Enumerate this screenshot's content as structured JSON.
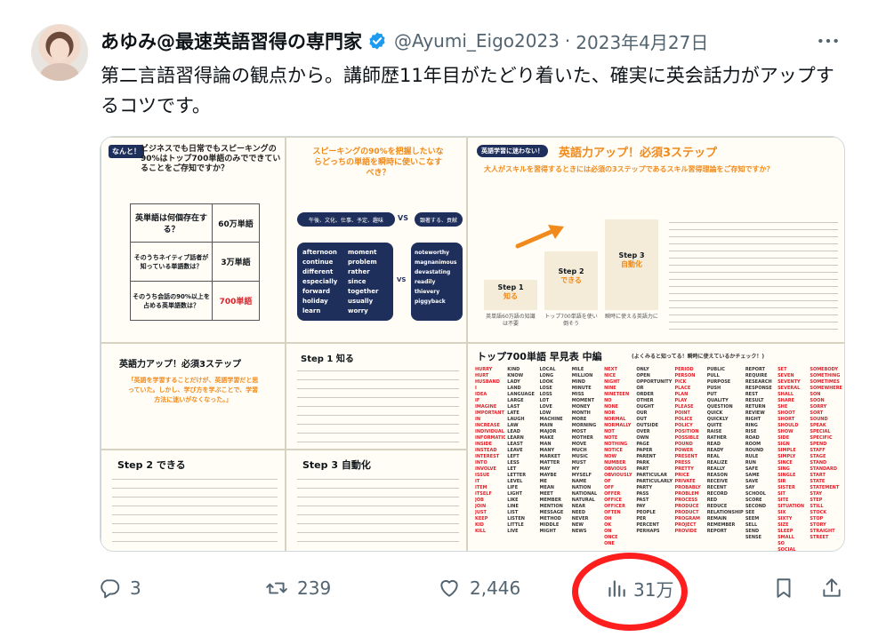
{
  "user": {
    "display_name": "あゆみ@最速英語習得の専門家",
    "handle": "@Ayumi_Eigo2023",
    "separator": "·",
    "date": "2023年4月27日"
  },
  "tweet_text": "第二言語習得論の観点から。講師歴11年目がたどり着いた、確実に英会話力がアップするコツです。",
  "media": {
    "p1_tag": "なんと！",
    "p1_title": "ビジネスでも日常でもスピーキングの90%はトップ700単語のみでできていることをご存知ですか？",
    "p1_rows": [
      {
        "q": "英単語は何個存在する？",
        "a": "60万単語"
      },
      {
        "q": "そのうちネイティブ話者が知っている単語数は？",
        "a": "3万単語"
      },
      {
        "q": "そのうち会話の90%以上を占める英単語数は？",
        "a": "700単語"
      }
    ],
    "p2_title": "スピーキングの90%を把握したいならどっちの単語を瞬時に使いこなすべき？",
    "p2_left_box": "午後、文化、仕事、予定、趣味",
    "p2_vs": "VS",
    "p2_right_box": "顕著する、貢献",
    "p2_left_words": [
      "afternoon",
      "continue",
      "different",
      "especially",
      "forward",
      "holiday",
      "learn"
    ],
    "p2_left_words2": [
      "moment",
      "problem",
      "rather",
      "since",
      "together",
      "usually",
      "worry"
    ],
    "p2_right_words": [
      "noteworthy",
      "magnanimous",
      "devastating",
      "readily",
      "thievery",
      "piggyback"
    ],
    "p3_tag": "英語学習に迷わない！",
    "p3_title": "英語力アップ！必須3ステップ",
    "p3_subtitle": "大人がスキルを習得するときには必須の3ステップであるスキル習得理論をご存知ですか？",
    "p3_steps": [
      {
        "label": "Step 1",
        "word": "知る",
        "desc": "英単語60万語の知識は不要"
      },
      {
        "label": "Step 2",
        "word": "できる",
        "desc": "トップ700単語を使い倒そう"
      },
      {
        "label": "Step 3",
        "word": "自動化",
        "desc": "瞬時に使える英語力に"
      }
    ],
    "p4_title": "英語力アップ！必須3ステップ",
    "p4_quote": "「英語を学習することだけが、英語学習だと思っていた。しかし、学び方を学ぶことで、学習方法に迷いがなくなった。」",
    "p5_title": "Step 1 知る",
    "p6_title": "トップ700単語 早見表 中編",
    "p6_note": "(よくみると知ってる！瞬時に使えているかチェック！)",
    "p6_words": [
      "HURRY",
      "HURT",
      "HUSBAND",
      "I",
      "IDEA",
      "IF",
      "IMAGINE",
      "IMPORTANT",
      "IN",
      "INCREASE",
      "INDIVIDUAL",
      "INFORMATION",
      "INSIDE",
      "INSTEAD",
      "INTEREST",
      "INTO",
      "INVOLVE",
      "ISSUE",
      "IT",
      "ITEM",
      "ITSELF",
      "JOB",
      "JOIN",
      "JUST",
      "KEEP",
      "KID",
      "KILL"
    ],
    "p6_words2": [
      "KIND",
      "KNOW",
      "LADY",
      "LAND",
      "LANGUAGE",
      "LARGE",
      "LAST",
      "LATE",
      "LAUGH",
      "LAW",
      "LEAD",
      "LEARN",
      "LEAST",
      "LEAVE",
      "LEFT",
      "LESS",
      "LET",
      "LETTER",
      "LEVEL",
      "LIFE",
      "LIGHT",
      "LIKE",
      "LINE",
      "LIST",
      "LISTEN",
      "LITTLE",
      "LIVE"
    ],
    "p6_words3": [
      "LOCAL",
      "LONG",
      "LOOK",
      "LOSE",
      "LOSS",
      "LOT",
      "LOVE",
      "LOW",
      "MACHINE",
      "MAIN",
      "MAJOR",
      "MAKE",
      "MAN",
      "MANY",
      "MARKET",
      "MATTER",
      "MAY",
      "MAYBE",
      "ME",
      "MEAN",
      "MEET",
      "MEMBER",
      "MENTION",
      "MESSAGE",
      "METHOD",
      "MIDDLE",
      "MIGHT"
    ],
    "p6_words4": [
      "MILE",
      "MILLION",
      "MIND",
      "MINUTE",
      "MISS",
      "MOMENT",
      "MONEY",
      "MONTH",
      "MORE",
      "MORNING",
      "MOST",
      "MOTHER",
      "MOVE",
      "MUCH",
      "MUSIC",
      "MUST",
      "MY",
      "MYSELF",
      "NAME",
      "NATION",
      "NATIONAL",
      "NATURAL",
      "NEAR",
      "NEED",
      "NEVER",
      "NEW",
      "NEWS"
    ],
    "p6_words5": [
      "NEXT",
      "NICE",
      "NIGHT",
      "NINE",
      "NINETEEN",
      "NO",
      "NONE",
      "NOR",
      "NORMAL",
      "NORMALLY",
      "NOT",
      "NOTE",
      "NOTHING",
      "NOTICE",
      "NOW",
      "NUMBER",
      "OBVIOUS",
      "OBVIOUSLY",
      "OF",
      "OFF",
      "OFFER",
      "OFFICE",
      "OFFICER",
      "OFTEN",
      "OH",
      "OK",
      "ON",
      "ONCE",
      "ONE"
    ],
    "p6_words6": [
      "ONLY",
      "OPEN",
      "OPPORTUNITY",
      "OR",
      "ORDER",
      "OTHER",
      "OUGHT",
      "OUR",
      "OUT",
      "OUTSIDE",
      "OVER",
      "OWN",
      "PAGE",
      "PAPER",
      "PARENT",
      "PARK",
      "PART",
      "PARTICULAR",
      "PARTICULARLY",
      "PARTY",
      "PASS",
      "PAST",
      "PAY",
      "PEOPLE",
      "PER",
      "PERCENT",
      "PERHAPS"
    ],
    "p6_words7": [
      "PERIOD",
      "PERSON",
      "PICK",
      "PLACE",
      "PLAN",
      "PLAY",
      "PLEASE",
      "POINT",
      "POLICE",
      "POLICY",
      "POSITION",
      "POSSIBLE",
      "POUND",
      "POWER",
      "PRESENT",
      "PRESS",
      "PRETTY",
      "PRICE",
      "PRIVATE",
      "PROBABLY",
      "PROBLEM",
      "PROCESS",
      "PRODUCE",
      "PRODUCT",
      "PROGRAM",
      "PROJECT",
      "PROVIDE"
    ],
    "p6_words8": [
      "PUBLIC",
      "PULL",
      "PURPOSE",
      "PUSH",
      "PUT",
      "QUALITY",
      "QUESTION",
      "QUICK",
      "QUICKLY",
      "QUITE",
      "RAISE",
      "RATHER",
      "READ",
      "READY",
      "REAL",
      "REALIZE",
      "REALLY",
      "REASON",
      "RECEIVE",
      "RECENT",
      "RECORD",
      "RED",
      "REDUCE",
      "RELATIONSHIP",
      "REMAIN",
      "REMEMBER",
      "REPORT"
    ],
    "p6_words9": [
      "REPORT",
      "REQUIRE",
      "RESEARCH",
      "RESPONSE",
      "REST",
      "RESULT",
      "RETURN",
      "REVIEW",
      "RIGHT",
      "RING",
      "RISE",
      "ROAD",
      "ROOM",
      "ROUND",
      "RULE",
      "RUN",
      "SAFE",
      "SAME",
      "SAVE",
      "SAY",
      "SCHOOL",
      "SCORE",
      "SECOND",
      "SEE",
      "SEEM",
      "SELL",
      "SEND",
      "SENSE"
    ],
    "p6_words10": [
      "SET",
      "SEVEN",
      "SEVENTY",
      "SEVERAL",
      "SHALL",
      "SHARE",
      "SHE",
      "SHOOT",
      "SHORT",
      "SHOULD",
      "SHOW",
      "SIDE",
      "SIGN",
      "SIMPLE",
      "SIMPLY",
      "SINCE",
      "SING",
      "SINGLE",
      "SIR",
      "SISTER",
      "SIT",
      "SITE",
      "SITUATION",
      "SIX",
      "SIXTY",
      "SIZE",
      "SLEEP",
      "SMALL",
      "SO",
      "SOCIAL"
    ],
    "p6_words11": [
      "SOMEBODY",
      "SOMETHING",
      "SOMETIMES",
      "SOMEWHERE",
      "SON",
      "SOON",
      "SORRY",
      "SORT",
      "SOUND",
      "SPEAK",
      "SPECIAL",
      "SPECIFIC",
      "SPEND",
      "STAFF",
      "STAGE",
      "STAND",
      "STANDARD",
      "START",
      "STATE",
      "STATEMENT",
      "STAY",
      "STEP",
      "STILL",
      "STOCK",
      "STOP",
      "STORY",
      "STRAIGHT",
      "STREET"
    ],
    "p7_title": "Step 2 できる",
    "p8_title": "Step 3 自動化"
  },
  "actions": {
    "reply_count": "3",
    "retweet_count": "239",
    "like_count": "2,446",
    "views_count": "31万"
  },
  "colors": {
    "verified": "#1d9bf0",
    "secondary_text": "#536471",
    "highlight_ring": "#ff1e1e",
    "accent_orange": "#f08a1c",
    "accent_red": "#e0202a",
    "navy": "#1f2f5c"
  }
}
